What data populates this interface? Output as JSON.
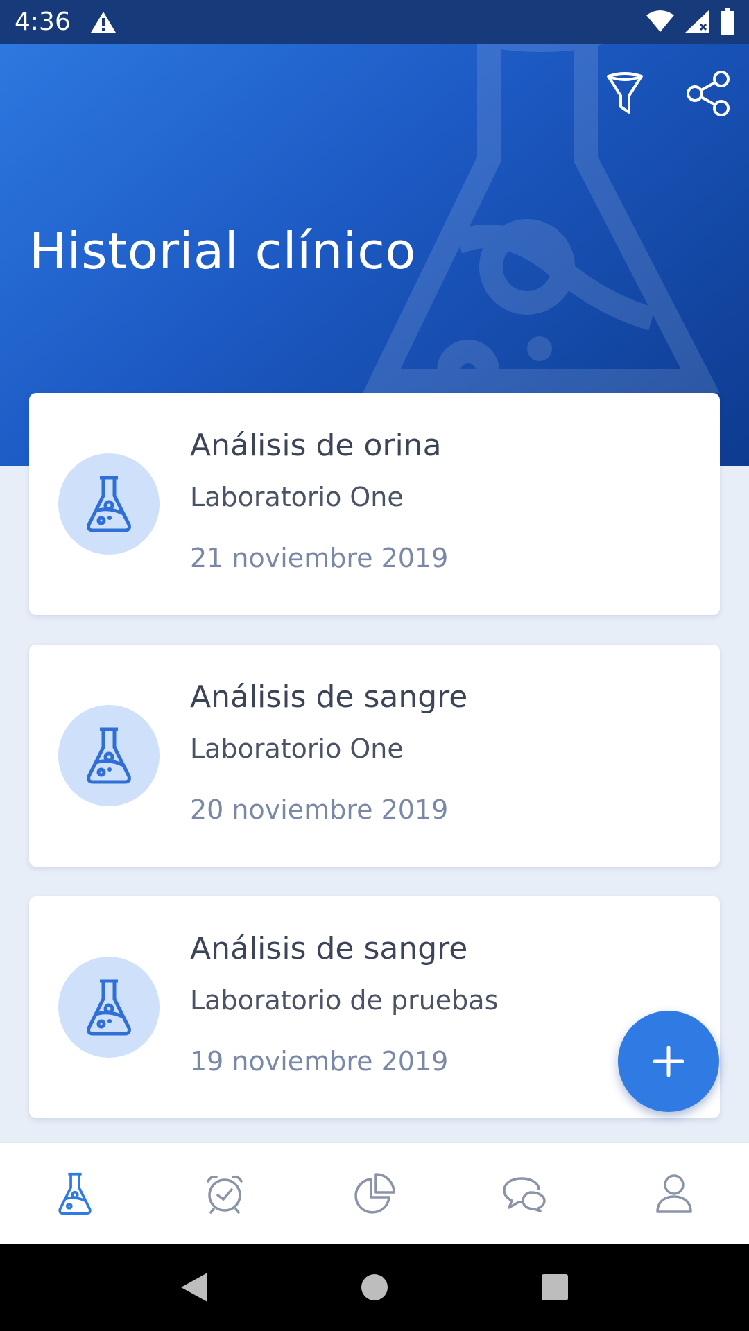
{
  "status_bar": {
    "time": "4:36"
  },
  "header": {
    "title": "Historial clínico"
  },
  "records": [
    {
      "title": "Análisis de orina",
      "lab": "Laboratorio One",
      "date": "21 noviembre 2019"
    },
    {
      "title": "Análisis de sangre",
      "lab": "Laboratorio One",
      "date": "20 noviembre 2019"
    },
    {
      "title": "Análisis de sangre",
      "lab": "Laboratorio de pruebas",
      "date": "19 noviembre 2019"
    }
  ],
  "bottom_nav": [
    {
      "icon": "flask-icon",
      "active": true
    },
    {
      "icon": "alarm-clock-icon",
      "active": false
    },
    {
      "icon": "pie-chart-icon",
      "active": false
    },
    {
      "icon": "chat-icon",
      "active": false
    },
    {
      "icon": "profile-icon",
      "active": false
    }
  ],
  "colors": {
    "accent": "#2f7be3",
    "header_dark": "#0d3b8f",
    "avatar_bg": "#cfe0fb",
    "nav_inactive": "#8a94a8"
  }
}
